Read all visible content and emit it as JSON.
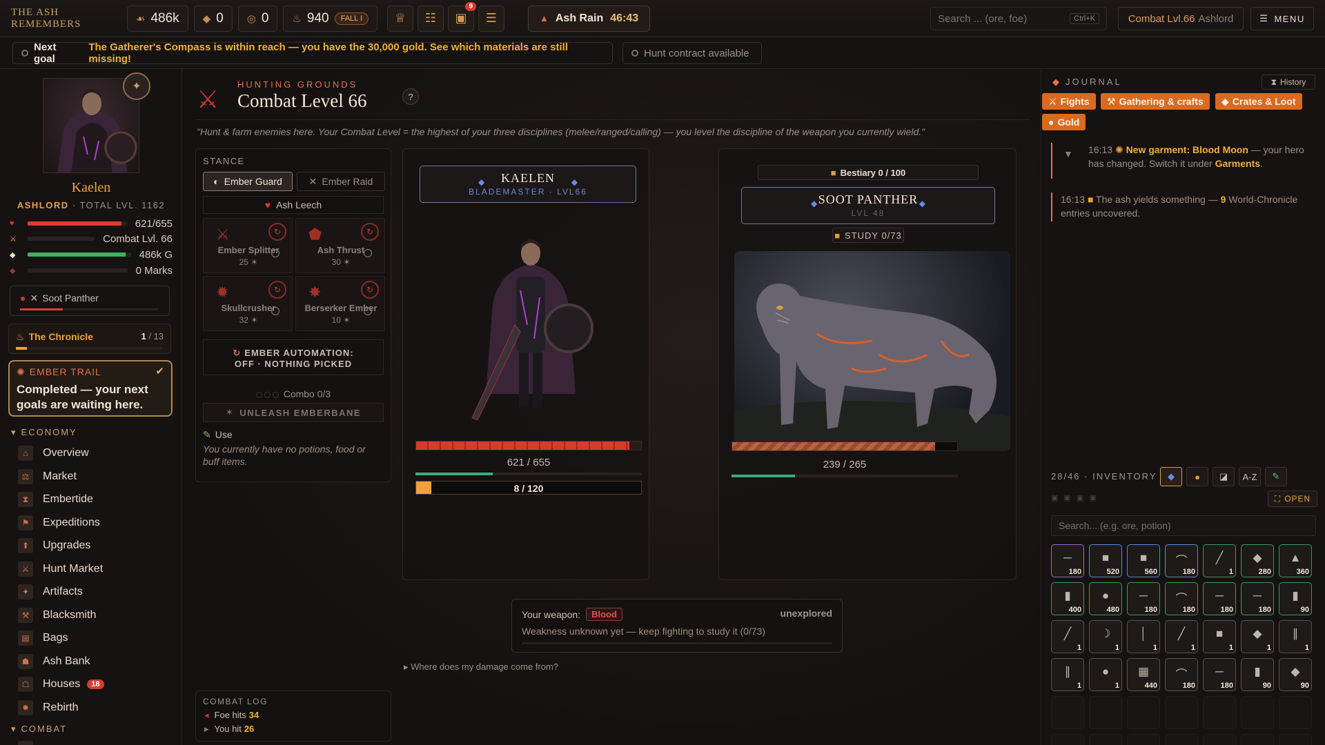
{
  "topbar": {
    "brand": "THE ASH REMEMBERS",
    "resources": [
      {
        "icon": "wing-icon",
        "glyph": "☙",
        "value": "486k"
      },
      {
        "icon": "diamond-icon",
        "glyph": "◆",
        "value": "0"
      },
      {
        "icon": "target-icon",
        "glyph": "◎",
        "value": "0"
      },
      {
        "icon": "flame-icon",
        "glyph": "♨",
        "value": "940",
        "pill": "FALL I"
      }
    ],
    "icon_buttons": [
      {
        "icon": "trophy-icon",
        "glyph": "♕"
      },
      {
        "icon": "scroll-icon",
        "glyph": "☷"
      },
      {
        "icon": "crate-icon",
        "glyph": "▣",
        "badge": "9"
      },
      {
        "icon": "book-icon",
        "glyph": "☰"
      }
    ],
    "event": {
      "label": "Ash Rain",
      "timer": "46:43"
    },
    "search_placeholder": "Search ... (ore, foe)",
    "search_shortcut": "Ctrl+K",
    "combat_label": "Combat Lvl.66",
    "combat_name": "Ashlord",
    "menu_label": "MENU"
  },
  "goalbar": {
    "label": "Next goal",
    "text": "The Gatherer's Compass is within reach — you have the 30,000 gold. See which materials are still missing!",
    "hunt": "Hunt contract available"
  },
  "sidebar": {
    "hero_name": "Kaelen",
    "hero_title": "ASHLORD",
    "hero_total": "· TOTAL LVL. 1162",
    "stats": [
      {
        "icon": "heart-icon",
        "glyph": "♥",
        "color": "#e03a30",
        "fill": 0.948,
        "value": "621/655"
      },
      {
        "icon": "swords-icon",
        "glyph": "⚔",
        "color": "#e0a040",
        "fill": 0,
        "value": "Combat Lvl. 66"
      },
      {
        "icon": "gold-icon",
        "glyph": "◆",
        "color": "#40b060",
        "fill": 0.95,
        "value": "486k G"
      },
      {
        "icon": "mark-icon",
        "glyph": "◆",
        "color": "#8a3a3a",
        "fill": 0,
        "value": "0 Marks"
      }
    ],
    "target": "Soot Panther",
    "chronicle": {
      "label": "The Chronicle",
      "current": "1",
      "total": "/ 13",
      "progress": 0.077
    },
    "trail": {
      "title": "EMBER TRAIL",
      "body": "Completed — your next goals are waiting here."
    },
    "economy_header": "ECONOMY",
    "nav": [
      {
        "label": "Overview",
        "icon": "overview-icon",
        "glyph": "⌂"
      },
      {
        "label": "Market",
        "icon": "market-icon",
        "glyph": "⚖"
      },
      {
        "label": "Embertide",
        "icon": "hourglass-icon",
        "glyph": "⧗"
      },
      {
        "label": "Expeditions",
        "icon": "map-icon",
        "glyph": "⚑"
      },
      {
        "label": "Upgrades",
        "icon": "upgrade-icon",
        "glyph": "⬆"
      },
      {
        "label": "Hunt Market",
        "icon": "hunt-market-icon",
        "glyph": "⚔"
      },
      {
        "label": "Artifacts",
        "icon": "artifact-icon",
        "glyph": "✦"
      },
      {
        "label": "Blacksmith",
        "icon": "anvil-icon",
        "glyph": "⚒"
      },
      {
        "label": "Bags",
        "icon": "bag-icon",
        "glyph": "▤"
      },
      {
        "label": "Ash Bank",
        "icon": "bank-icon",
        "glyph": "☗"
      },
      {
        "label": "Houses",
        "icon": "house-icon",
        "glyph": "☖",
        "badge": "18"
      },
      {
        "label": "Rebirth",
        "icon": "rebirth-icon",
        "glyph": "✸"
      }
    ],
    "combat_header": "COMBAT"
  },
  "main": {
    "kicker": "HUNTING GROUNDS",
    "title": "Combat Level 66",
    "help": "?",
    "quote": "\"Hunt & farm enemies here. Your Combat Level = the highest of your three disciplines (melee/ranged/calling) — you level the discipline of the weapon you currently wield.\"",
    "stance": {
      "header": "STANCE",
      "tabs": [
        "Ember Guard",
        "Ember Raid"
      ],
      "leech": "Ash Leech",
      "skills": [
        {
          "name": "Ember Splitter",
          "cost": "25"
        },
        {
          "name": "Ash Thrust",
          "cost": "30"
        },
        {
          "name": "Skullcrusher",
          "cost": "32"
        },
        {
          "name": "Berserker Ember",
          "cost": "10"
        }
      ],
      "automation_line1": "EMBER AUTOMATION:",
      "automation_line2": "OFF · NOTHING PICKED",
      "combo": "Combo 0/3",
      "unleash": "UNLEASH EMBERBANE",
      "use_label": "Use",
      "use_text": "You currently have no potions, food or buff items."
    },
    "hero": {
      "name": "KAELEN",
      "sub": "BLADEMASTER · LVL66",
      "hp_text": "621 / 655",
      "hp_fill": 0.948,
      "stamina_fill": 0.34,
      "xp_text": "8 / 120",
      "xp_fill": 0.067
    },
    "foe": {
      "bestiary": "Bestiary 0 / 100",
      "name": "SOOT PANTHER",
      "sub": "LVL 48",
      "study": "STUDY 0/73",
      "hp_text": "239 / 265",
      "hp_fill": 0.902,
      "stamina_fill": 0.28
    },
    "weapon": {
      "label": "Your weapon:",
      "tag": "Blood",
      "status": "unexplored",
      "text": "Weakness unknown yet — keep fighting to study it (0/73)"
    },
    "where": "Where does my damage come from?",
    "combat_log": {
      "header": "COMBAT LOG",
      "rows": [
        {
          "label": "Foe hits",
          "value": "34"
        },
        {
          "label": "You hit",
          "value": "26"
        }
      ]
    }
  },
  "journal": {
    "header": "JOURNAL",
    "history": "History",
    "filters": [
      "Fights",
      "Gathering & crafts",
      "Crates & Loot",
      "Gold"
    ],
    "entries": [
      {
        "time": "16:13",
        "title": "New garment: Blood Moon",
        "rest": "— your hero has changed. Switch it under",
        "link": "Garments",
        "end": "."
      },
      {
        "time": "16:13",
        "pre": "The ash yields something —",
        "num": "9",
        "post": "World-Chronicle entries uncovered."
      }
    ]
  },
  "inventory": {
    "count": "28/46",
    "label": "· INVENTORY",
    "sort": "A-Z",
    "open": "OPEN",
    "search_placeholder": "Search... (e.g. ore, potion)",
    "slots": [
      {
        "q": "180",
        "c": "#9a6ad0",
        "g": "─"
      },
      {
        "q": "520",
        "c": "#5a8ae0",
        "g": "■"
      },
      {
        "q": "560",
        "c": "#5a8ae0",
        "g": "■"
      },
      {
        "q": "180",
        "c": "#5a8ae0",
        "g": "⌒"
      },
      {
        "q": "1",
        "c": "#3a9a60",
        "g": "╱"
      },
      {
        "q": "280",
        "c": "#3a9a60",
        "g": "◆"
      },
      {
        "q": "360",
        "c": "#3a9a60",
        "g": "▲"
      },
      {
        "q": "400",
        "c": "#3a9a60",
        "g": "▮"
      },
      {
        "q": "480",
        "c": "#3a9a60",
        "g": "●"
      },
      {
        "q": "180",
        "c": "#3a9a60",
        "g": "─"
      },
      {
        "q": "180",
        "c": "#3a9a60",
        "g": "⌒"
      },
      {
        "q": "180",
        "c": "#3a9a60",
        "g": "─"
      },
      {
        "q": "180",
        "c": "#3a9a60",
        "g": "─"
      },
      {
        "q": "90",
        "c": "#3a9a60",
        "g": "▮"
      },
      {
        "q": "1",
        "c": "#5a504a",
        "g": "╱"
      },
      {
        "q": "1",
        "c": "#5a504a",
        "g": "☽"
      },
      {
        "q": "1",
        "c": "#5a504a",
        "g": "│"
      },
      {
        "q": "1",
        "c": "#5a504a",
        "g": "╱"
      },
      {
        "q": "1",
        "c": "#5a504a",
        "g": "■"
      },
      {
        "q": "1",
        "c": "#5a504a",
        "g": "◆"
      },
      {
        "q": "1",
        "c": "#5a504a",
        "g": "∥"
      },
      {
        "q": "1",
        "c": "#5a504a",
        "g": "∥"
      },
      {
        "q": "1",
        "c": "#5a504a",
        "g": "●"
      },
      {
        "q": "440",
        "c": "#5a504a",
        "g": "▦"
      },
      {
        "q": "180",
        "c": "#5a504a",
        "g": "⌒"
      },
      {
        "q": "180",
        "c": "#5a504a",
        "g": "─"
      },
      {
        "q": "90",
        "c": "#5a504a",
        "g": "▮"
      },
      {
        "q": "90",
        "c": "#5a504a",
        "g": "◆"
      }
    ]
  }
}
